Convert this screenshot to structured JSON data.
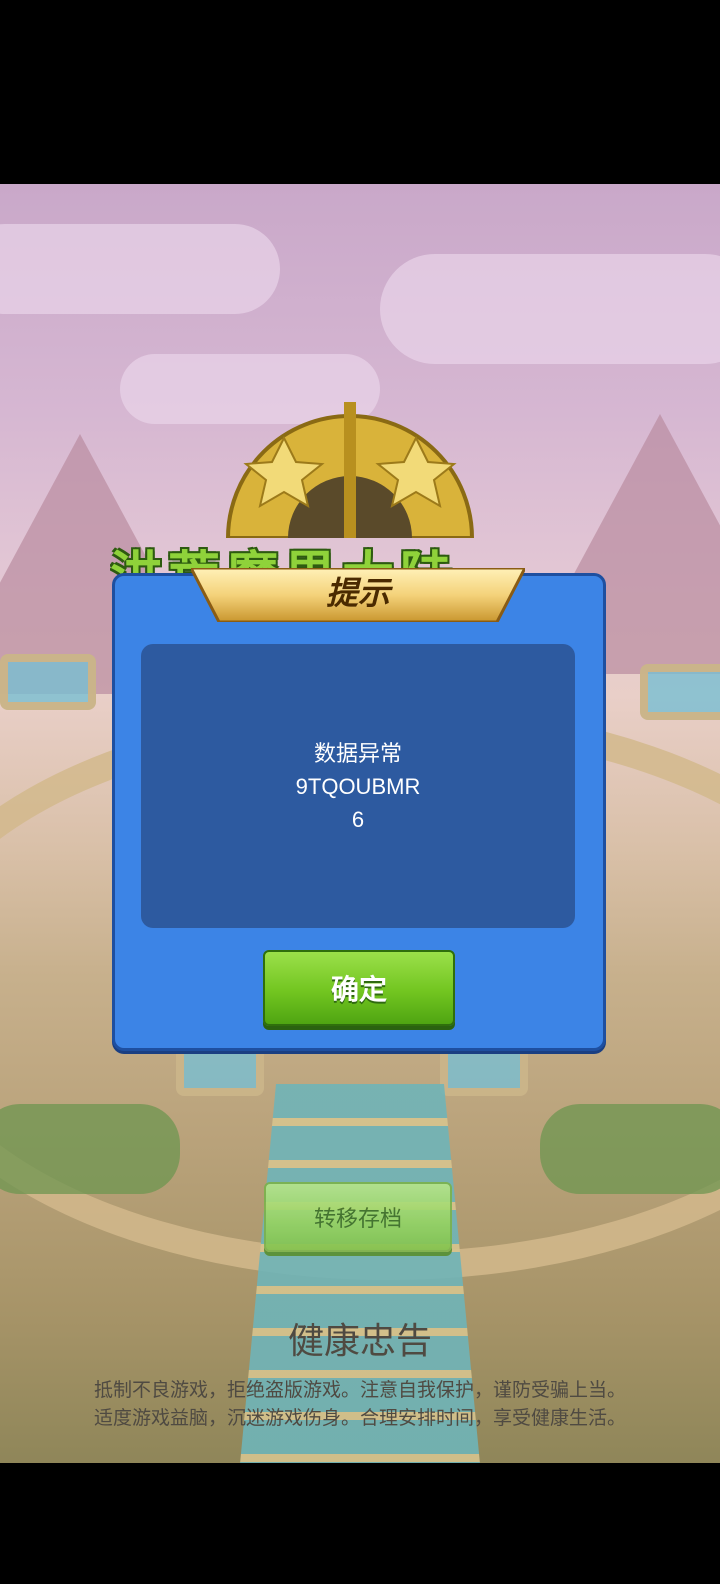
{
  "game": {
    "logo_title": "洪荒魔界大陆"
  },
  "dialog": {
    "title": "提示",
    "message_lines": [
      "数据异常",
      "9TQOUBMR",
      "6"
    ],
    "ok_label": "确定"
  },
  "transfer_button": {
    "label": "转移存档"
  },
  "health_notice": {
    "title": "健康忠告",
    "line1": "抵制不良游戏，拒绝盗版游戏。注意自我保护，谨防受骗上当。",
    "line2": "适度游戏益脑，沉迷游戏伤身。合理安排时间，享受健康生活。"
  },
  "colors": {
    "dialog_bg": "#3c84e6",
    "content_bg": "#2d5aa0",
    "ok_button": "#72c520",
    "title_banner": "#f4d27a"
  }
}
